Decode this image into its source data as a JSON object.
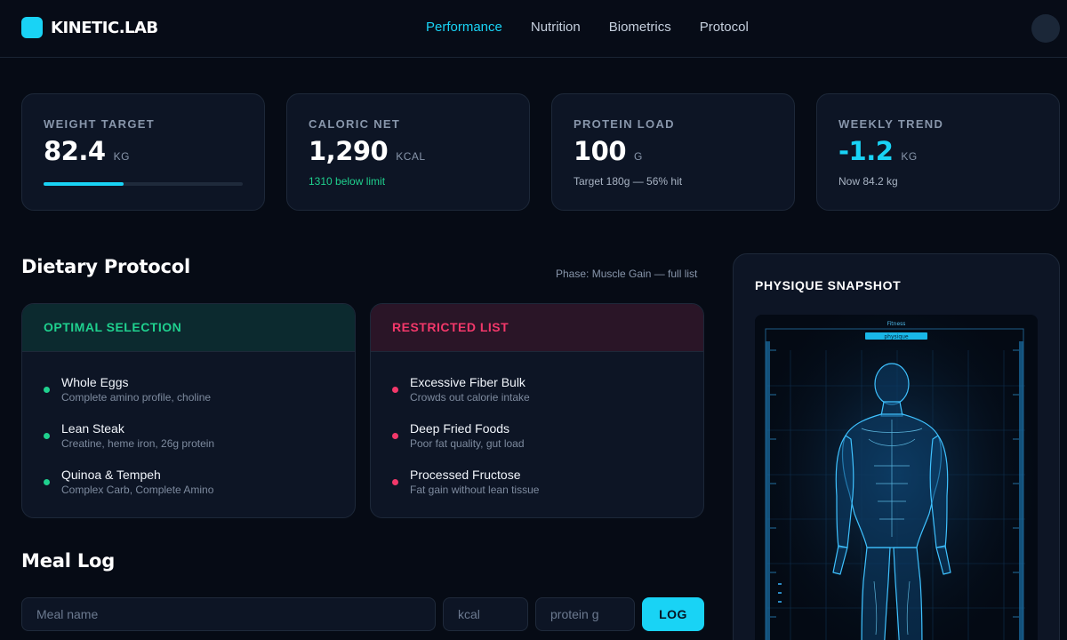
{
  "brand": {
    "name": "KINETIC.LAB"
  },
  "nav": {
    "items": [
      {
        "label": "Performance",
        "active": true
      },
      {
        "label": "Nutrition",
        "active": false
      },
      {
        "label": "Biometrics",
        "active": false
      },
      {
        "label": "Protocol",
        "active": false
      }
    ]
  },
  "stats": [
    {
      "label": "WEIGHT TARGET",
      "value": "82.4",
      "unit": "KG",
      "progress": 0.4
    },
    {
      "label": "CALORIC NET",
      "value": "1,290",
      "unit": "KCAL",
      "sub": "1310 below limit"
    },
    {
      "label": "PROTEIN LOAD",
      "value": "100",
      "unit": "G",
      "sub": "Target 180g — 56% hit"
    },
    {
      "label": "WEEKLY TREND",
      "value": "-1.2",
      "unit": "KG",
      "sub": "Now 84.2 kg"
    }
  ],
  "diet": {
    "title": "Dietary Protocol",
    "phase": "Phase: Muscle Gain — full list",
    "optimal": {
      "header": "OPTIMAL SELECTION",
      "items": [
        {
          "title": "Whole Eggs",
          "sub": "Complete amino profile, choline"
        },
        {
          "title": "Lean Steak",
          "sub": "Creatine, heme iron, 26g protein"
        },
        {
          "title": "Quinoa & Tempeh",
          "sub": "Complex Carb, Complete Amino"
        }
      ]
    },
    "restricted": {
      "header": "RESTRICTED LIST",
      "items": [
        {
          "title": "Excessive Fiber Bulk",
          "sub": "Crowds out calorie intake"
        },
        {
          "title": "Deep Fried Foods",
          "sub": "Poor fat quality, gut load"
        },
        {
          "title": "Processed Fructose",
          "sub": "Fat gain without lean tissue"
        }
      ]
    }
  },
  "meal_log": {
    "title": "Meal Log",
    "name_placeholder": "Meal name",
    "kcal_placeholder": "kcal",
    "protein_placeholder": "protein g",
    "button_label": "LOG"
  },
  "physique": {
    "title": "PHYSIQUE SNAPSHOT",
    "image_caption": "Fitness",
    "image_tag": "physique"
  },
  "colors": {
    "accent": "#19d3f5",
    "positive": "#1fd08e",
    "negative": "#f2386a",
    "background": "#060b15",
    "card": "#0d1525"
  }
}
